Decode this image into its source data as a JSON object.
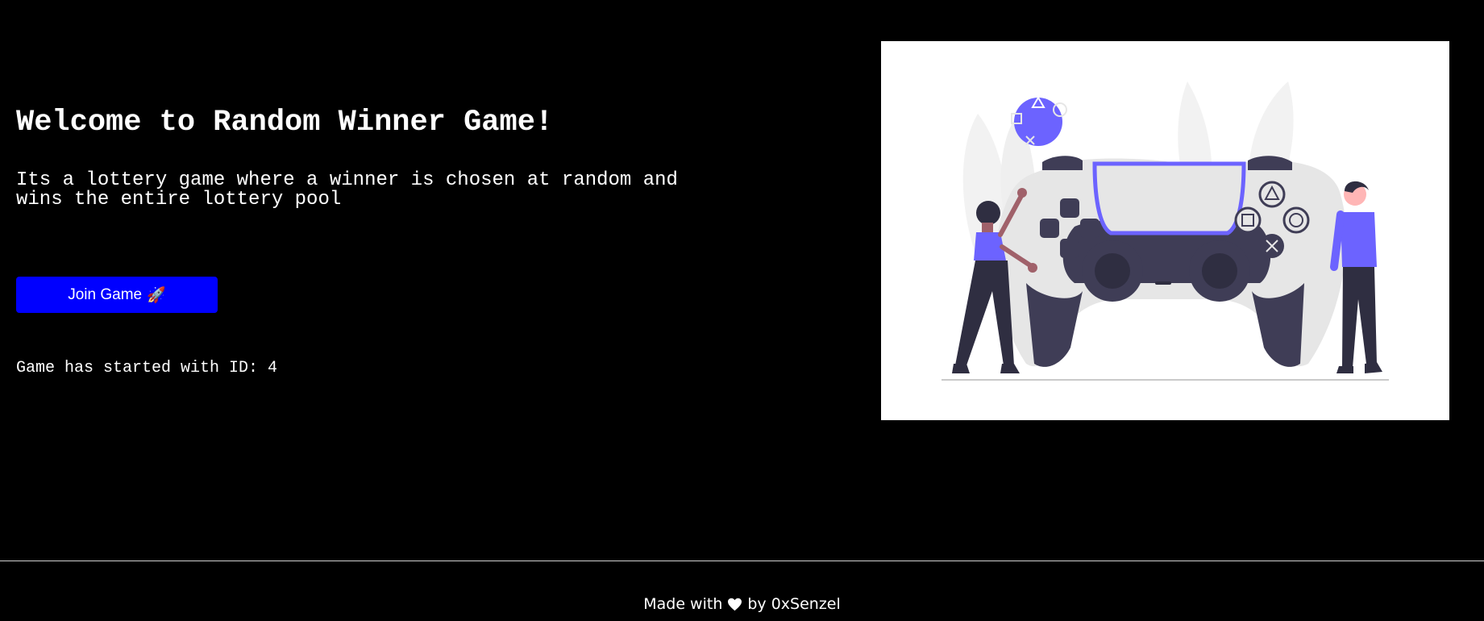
{
  "hero": {
    "title": "Welcome to Random Winner Game!",
    "description": "Its a lottery game where a winner is chosen at random and wins the entire lottery pool",
    "join_button_label": "Join Game",
    "join_button_icon": "rocket-icon",
    "status_text": "Game has started with ID: 4"
  },
  "illustration": {
    "icon": "game-controller-illustration",
    "accent_color": "#6c63ff"
  },
  "footer": {
    "made_with": "Made with",
    "heart_icon": "heart-icon",
    "by_text": "by 0xSenzel"
  },
  "colors": {
    "background": "#000000",
    "button": "#0000ff",
    "text": "#ffffff"
  }
}
